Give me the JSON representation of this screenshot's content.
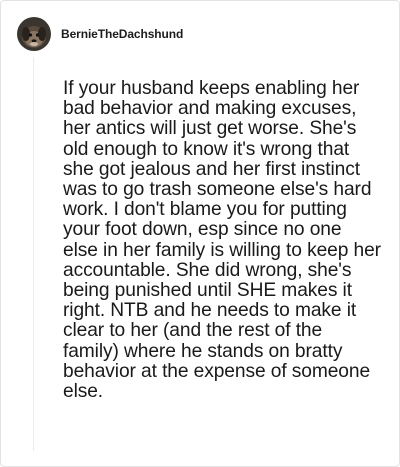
{
  "comment": {
    "author": "BernieTheDachshund",
    "avatar_icon": "dachshund-avatar-icon",
    "body": "If your husband keeps enabling her bad behavior and making excuses, her antics will just get worse. She's old enough to know it's wrong that she got jealous and her first instinct was to go trash someone else's hard work. I don't blame you for putting your foot down, esp since no one else in her family is willing to keep her accountable. She did wrong, she's being punished until SHE makes it right. NTB and he needs to make it clear to her (and the rest of the family) where he stands on bratty behavior at the expense of someone else."
  }
}
